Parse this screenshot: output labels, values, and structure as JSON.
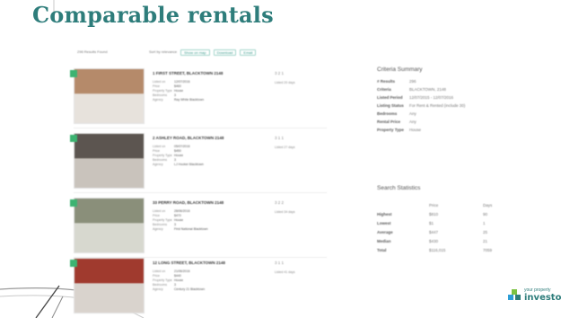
{
  "slide": {
    "title": "Comparable rentals"
  },
  "results": {
    "label": "296 Results Found"
  },
  "toolbar": {
    "sort_label": "Sort by relevance",
    "chips": [
      "Show on map",
      "Download",
      "Email"
    ]
  },
  "listings": [
    {
      "address": "1 FIRST STREET, BLACKTOWN 2148",
      "fields": [
        "Listed on",
        "Price",
        "Property Type",
        "Bedrooms",
        "Agency"
      ],
      "values": [
        "12/07/2016",
        "$460",
        "House",
        "3",
        "Ray White Blacktown"
      ],
      "icons": "3 2 1",
      "listing": "Listed 20 days",
      "color_top": "#b58a6a",
      "color_bottom": "#e7e2dc"
    },
    {
      "address": "2 ASHLEY ROAD, BLACKTOWN 2148",
      "fields": [
        "Listed on",
        "Price",
        "Property Type",
        "Bedrooms",
        "Agency"
      ],
      "values": [
        "05/07/2016",
        "$450",
        "House",
        "3",
        "LJ Hooker Blacktown"
      ],
      "icons": "3 1 1",
      "listing": "Listed 27 days",
      "color_top": "#5c5550",
      "color_bottom": "#c9c3bc"
    },
    {
      "address": "33 PERRY ROAD, BLACKTOWN 2148",
      "fields": [
        "Listed on",
        "Price",
        "Property Type",
        "Bedrooms",
        "Agency"
      ],
      "values": [
        "28/06/2016",
        "$470",
        "House",
        "3",
        "First National Blacktown"
      ],
      "icons": "3 2 2",
      "listing": "Listed 34 days",
      "color_top": "#8a8f7a",
      "color_bottom": "#d7d8cf"
    },
    {
      "address": "12 LONG STREET, BLACKTOWN 2148",
      "fields": [
        "Listed on",
        "Price",
        "Property Type",
        "Bedrooms",
        "Agency"
      ],
      "values": [
        "21/06/2016",
        "$440",
        "House",
        "3",
        "Century 21 Blacktown"
      ],
      "icons": "3 1 1",
      "listing": "Listed 41 days",
      "color_top": "#a03a2e",
      "color_bottom": "#d9d3cd"
    }
  ],
  "criteria": {
    "title": "Criteria Summary",
    "rows": [
      {
        "key": "# Results",
        "value": "296"
      },
      {
        "key": "Criteria",
        "value": "BLACKTOWN, 2148"
      },
      {
        "key": "Listed Period",
        "value": "12/07/2015 - 12/07/2016"
      },
      {
        "key": "Listing Status",
        "value": "For Rent & Rented (include 30)"
      },
      {
        "key": "Bedrooms",
        "value": "Any"
      },
      {
        "key": "Rental Price",
        "value": "Any"
      },
      {
        "key": "Property Type",
        "value": "House"
      }
    ]
  },
  "stats": {
    "title": "Search Statistics",
    "headers": [
      "Price",
      "Days"
    ],
    "rows": [
      {
        "key": "Highest",
        "price": "$810",
        "days": "90"
      },
      {
        "key": "Lowest",
        "price": "$1",
        "days": "1"
      },
      {
        "key": "Average",
        "price": "$447",
        "days": "25"
      },
      {
        "key": "Median",
        "price": "$430",
        "days": "21"
      },
      {
        "key": "Total",
        "price": "$116,015",
        "days": "7059"
      }
    ]
  },
  "logo": {
    "small": "your property",
    "big": "investor"
  }
}
